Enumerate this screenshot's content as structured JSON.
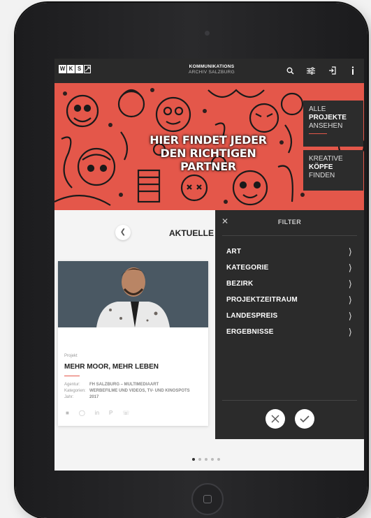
{
  "header": {
    "logo_letters": [
      "W",
      "K",
      "S"
    ],
    "brand_line1": "KOMMUNIKATIONS",
    "brand_line2": "ARCHIV SALZBURG",
    "icons": [
      "search-icon",
      "sliders-icon",
      "login-icon",
      "info-icon"
    ]
  },
  "hero": {
    "title_line1": "HIER FINDET JEDER",
    "title_line2": "DEN RICHTIGEN PARTNER",
    "cta_projects": {
      "line1": "ALLE",
      "line2": "PROJEKTE",
      "line3": "ANSEHEN"
    },
    "cta_creatives": {
      "line1": "KREATIVE",
      "line2": "KÖPFE",
      "line3": "FINDEN"
    }
  },
  "content": {
    "section_title": "AKTUELLE P",
    "card": {
      "label": "Projekt",
      "title": "MEHR MOOR, MEHR LEBEN",
      "meta": [
        {
          "key": "Agentur:",
          "value": "FH SALZBURG – MULTIMEDIAART"
        },
        {
          "key": "Kategorien:",
          "value": "WERBEFILME UND VIDEOS, TV- UND KINOSPOTS"
        },
        {
          "key": "Jahr:",
          "value": "2017"
        }
      ],
      "share_icons": [
        "facebook-icon",
        "instagram-icon",
        "linkedin-icon",
        "pinterest-icon",
        "whatsapp-icon"
      ]
    },
    "pagination": {
      "count": 5,
      "active": 0
    }
  },
  "filter": {
    "title": "FILTER",
    "items": [
      "ART",
      "KATEGORIE",
      "BEZIRK",
      "PROJEKTZEITRAUM",
      "LANDESPREIS",
      "ERGEBNISSE"
    ]
  },
  "colors": {
    "accent": "#e4574a",
    "panel": "#2b2b2b",
    "bar": "#2a2a2a"
  }
}
